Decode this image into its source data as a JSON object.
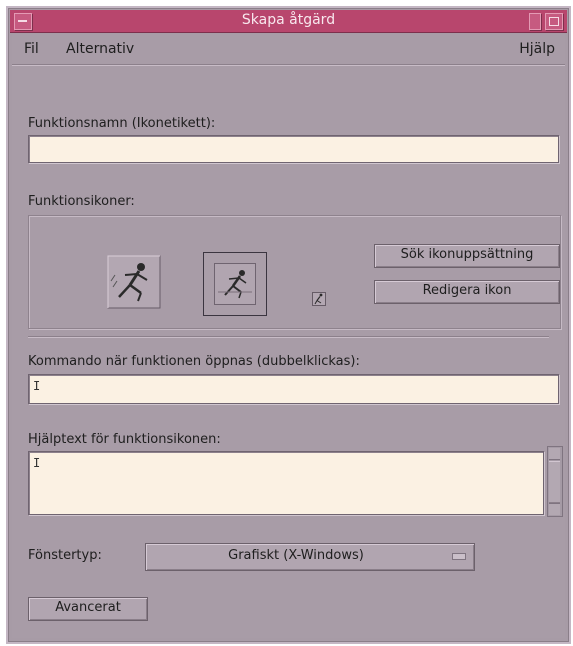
{
  "window": {
    "title": "Skapa åtgärd"
  },
  "menubar": {
    "file": "Fil",
    "options": "Alternativ",
    "help": "Hjälp"
  },
  "action_name": {
    "label": "Funktionsnamn (Ikonetikett):",
    "value": ""
  },
  "icons": {
    "label": "Funktionsikoner:",
    "find_set_button": "Sök ikonuppsättning",
    "edit_icon_button": "Redigera ikon",
    "sizes": [
      "large",
      "medium",
      "small"
    ]
  },
  "command": {
    "label": "Kommando när funktionen öppnas (dubbelklickas):",
    "value": ""
  },
  "help_text": {
    "label": "Hjälptext för funktionsikonen:",
    "value": ""
  },
  "window_type": {
    "label": "Fönstertyp:",
    "value": "Grafiskt (X-Windows)"
  },
  "advanced_button": "Avancerat",
  "colors": {
    "titlebar": "#b8466d",
    "panel": "#a89ca7",
    "field": "#fbf1e3"
  }
}
